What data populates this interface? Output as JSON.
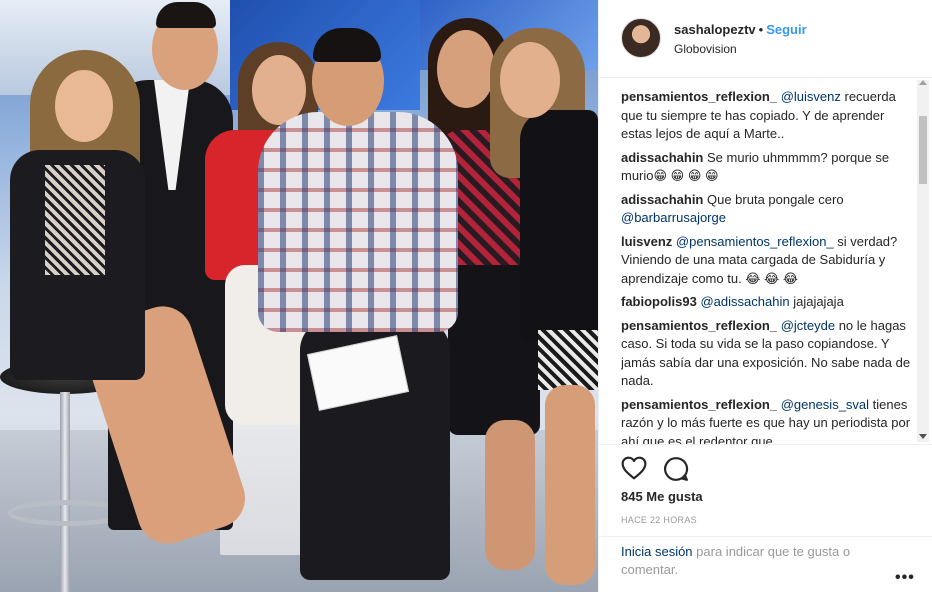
{
  "post": {
    "username": "sashalopeztv",
    "separator": "•",
    "follow_label": "Seguir",
    "location": "Globovision"
  },
  "comments": [
    {
      "author": "pensamientos_reflexion_",
      "mention": "@luisvenz",
      "text": "recuerda que tu siempre te has copiado. Y de aprender estas lejos de aquí a Marte.."
    },
    {
      "author": "adissachahin",
      "text": "Se murio uhmmmm? porque se murio😁 😁 😁 😁"
    },
    {
      "author": "adissachahin",
      "text": "Que bruta pongale cero",
      "mention_after": "@barbarrusajorge"
    },
    {
      "author": "luisvenz",
      "mention": "@pensamientos_reflexion_",
      "text": "si verdad? Viniendo de una mata cargada de Sabiduría y aprendizaje como tu. 😂 😂 😂"
    },
    {
      "author": "fabiopolis93",
      "mention": "@adissachahin",
      "text": "jajajajaja"
    },
    {
      "author": "pensamientos_reflexion_",
      "mention": "@jcteyde",
      "text": "no le hagas caso. Si toda su vida se la paso copiandose. Y jamás sabía dar una exposición. No sabe nada de nada."
    },
    {
      "author": "pensamientos_reflexion_",
      "mention": "@genesis_sval",
      "text": "tienes razón y lo más fuerte es que hay un periodista por ahí que es el redentor que"
    }
  ],
  "likes": "845 Me gusta",
  "time": "HACE 22 HORAS",
  "login": {
    "link": "Inicia sesión",
    "text": "para indicar que te gusta o comentar."
  },
  "more_label": "•••",
  "colors": {
    "accent": "#3897f0",
    "link": "#003569",
    "text": "#262626",
    "muted": "#999999"
  },
  "icons": [
    "heart-icon",
    "comment-icon",
    "more-icon"
  ]
}
